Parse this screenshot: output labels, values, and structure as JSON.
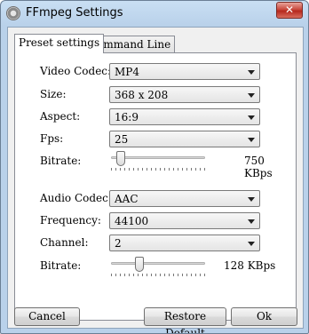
{
  "window": {
    "title": "FFmpeg Settings",
    "close_symbol": "✕"
  },
  "tabs": [
    {
      "label": "Preset settings",
      "active": true
    },
    {
      "label": "Command Line",
      "active": false
    }
  ],
  "video": {
    "codec": {
      "label": "Video Codec:",
      "value": "MP4"
    },
    "size": {
      "label": "Size:",
      "value": "368 x 208"
    },
    "aspect": {
      "label": "Aspect:",
      "value": "16:9"
    },
    "fps": {
      "label": "Fps:",
      "value": "25"
    },
    "bitrate": {
      "label": "Bitrate:",
      "value": "750 KBps",
      "level": 0.06
    }
  },
  "audio": {
    "codec": {
      "label": "Audio Codec:",
      "value": "AAC"
    },
    "frequency": {
      "label": "Frequency:",
      "value": "44100"
    },
    "channel": {
      "label": "Channel:",
      "value": "2"
    },
    "bitrate": {
      "label": "Bitrate:",
      "value": "128 KBps",
      "level": 0.28
    }
  },
  "buttons": {
    "cancel": "Cancel",
    "restore": "Restore Default",
    "ok": "Ok"
  },
  "icons": {
    "app": "gear-icon",
    "close": "close-icon",
    "dropdown": "chevron-down-icon"
  }
}
